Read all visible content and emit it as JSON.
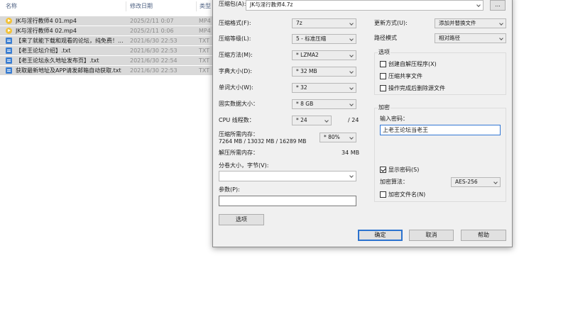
{
  "file_list": {
    "columns": {
      "name": "名称",
      "modified": "修改日期",
      "type": "类型"
    },
    "rows": [
      {
        "name": "JK与淫行教师4 01.mp4",
        "date": "2025/2/11 0:07",
        "type": "MP4",
        "icon": "video-file-icon"
      },
      {
        "name": "JK与淫行教师4 02.mp4",
        "date": "2025/2/11 0:06",
        "type": "MP4",
        "icon": "video-file-icon"
      },
      {
        "name": "【来了就能下载和观看的论坛，纯免费！...",
        "date": "2021/6/30 22:53",
        "type": "TXT",
        "icon": "text-file-icon"
      },
      {
        "name": "【老王论坛介绍】.txt",
        "date": "2021/6/30 22:53",
        "type": "TXT",
        "icon": "text-file-icon"
      },
      {
        "name": "【老王论坛永久地址发布页】.txt",
        "date": "2021/6/30 22:54",
        "type": "TXT",
        "icon": "text-file-icon"
      },
      {
        "name": "获取最新地址及APP请发邮箱自动获取.txt",
        "date": "2021/6/30 22:53",
        "type": "TXT",
        "icon": "text-file-icon"
      }
    ]
  },
  "dialog": {
    "archive_label": "压缩包(A):",
    "archive_path": "JK与淫行教师4.7z",
    "browse_label": "...",
    "format_label": "压缩格式(F):",
    "format_value": "7z",
    "level_label": "压缩等级(L):",
    "level_value": "5 - 标准压缩",
    "method_label": "压缩方法(M):",
    "method_value": "* LZMA2",
    "dict_label": "字典大小(D):",
    "dict_value": "* 32 MB",
    "word_label": "单词大小(W):",
    "word_value": "* 32",
    "solid_label": "固实数据大小：",
    "solid_value": "* 8 GB",
    "threads_label": "CPU 线程数：",
    "threads_value": "* 24",
    "threads_total": "/ 24",
    "mem_label": "压缩所需内存：",
    "mem_detail": "7264 MB / 13032 MB / 16289 MB",
    "mem_percent": "* 80%",
    "decomp_label": "解压所需内存：",
    "decomp_value": "34 MB",
    "split_label": "分卷大小，字节(V):",
    "split_value": "",
    "params_label": "参数(P):",
    "params_value": "",
    "options_button": "选项",
    "update_label": "更新方式(U):",
    "update_value": "添加并替换文件",
    "path_mode_label": "路径模式",
    "path_mode_value": "相对路径",
    "options_group": "选项",
    "opt_sfx": "创建自解压程序(X)",
    "opt_shared": "压缩共享文件",
    "opt_delete": "操作完成后删除源文件",
    "encrypt_group": "加密",
    "password_label": "输入密码：",
    "password_value": "上老王论坛当老王",
    "show_password": "显示密码(S)",
    "enc_method_label": "加密算法：",
    "enc_method_value": "AES-256",
    "encrypt_names": "加密文件名(N)",
    "ok_button": "确定",
    "cancel_button": "取消",
    "help_button": "帮助"
  }
}
